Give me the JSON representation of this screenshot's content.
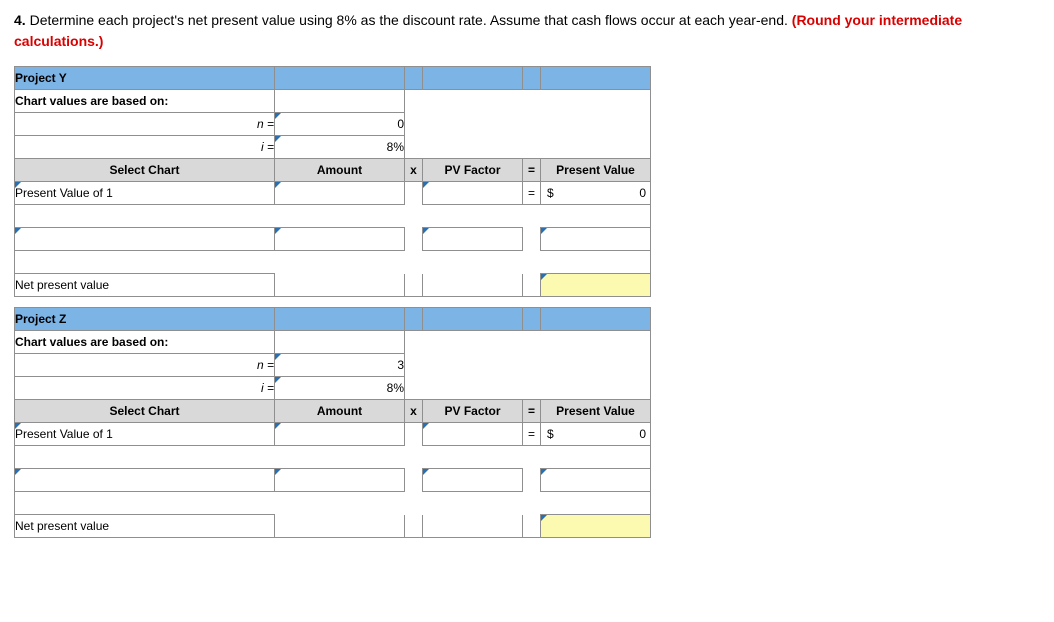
{
  "prompt": {
    "number": "4.",
    "text": "Determine each project's net present value using 8% as the discount rate. Assume that cash flows occur at each year-end.",
    "hint": "(Round your intermediate calculations.)"
  },
  "headers": {
    "select_chart": "Select Chart",
    "amount": "Amount",
    "x": "x",
    "pv_factor": "PV Factor",
    "eq": "=",
    "present_value": "Present Value",
    "chart_basis": "Chart values are based on:",
    "n_eq": "n =",
    "i_eq": "i =",
    "dollar": "$"
  },
  "projects": [
    {
      "title": "Project Y",
      "n": "0",
      "i": "8%",
      "rows": [
        {
          "chart": "Present Value of 1",
          "amount": "",
          "factor": "",
          "pv": "0"
        },
        {
          "chart": "",
          "amount": "",
          "factor": "",
          "pv": ""
        }
      ],
      "npv_label": "Net present value",
      "npv_value": ""
    },
    {
      "title": "Project Z",
      "n": "3",
      "i": "8%",
      "rows": [
        {
          "chart": "Present Value of 1",
          "amount": "",
          "factor": "",
          "pv": "0"
        },
        {
          "chart": "",
          "amount": "",
          "factor": "",
          "pv": ""
        }
      ],
      "npv_label": "Net present value",
      "npv_value": ""
    }
  ]
}
